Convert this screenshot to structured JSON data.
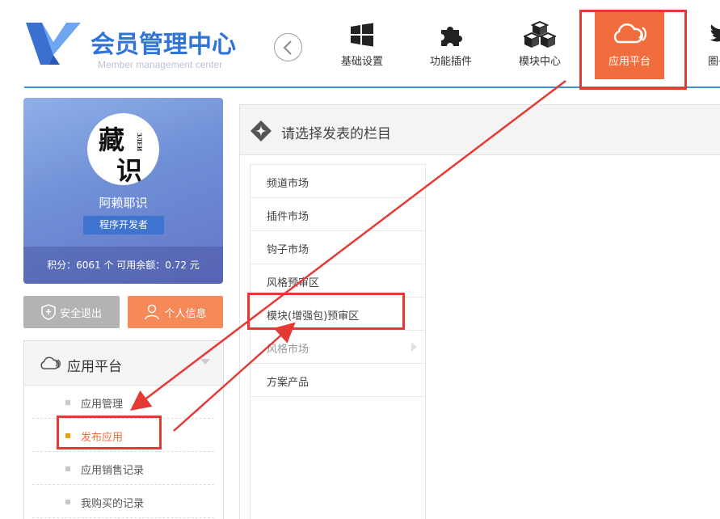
{
  "header": {
    "logo_title": "会员管理中心",
    "logo_subtitle": "Member management center",
    "nav": [
      {
        "label": "基础设置",
        "icon": "windows-icon"
      },
      {
        "label": "功能插件",
        "icon": "puzzle-icon"
      },
      {
        "label": "模块中心",
        "icon": "cubes-icon"
      },
      {
        "label": "应用平台",
        "icon": "cloud-icon",
        "active": true
      },
      {
        "label": "圈子",
        "icon": "twitter-bird-icon"
      }
    ]
  },
  "profile": {
    "avatar_text": [
      "藏",
      "识"
    ],
    "avatar_side_text": "ЗЛЕИ",
    "username": "阿赖耶识",
    "role": "程序开发者",
    "stats": "积分：6061  个  可用余额：0.72  元"
  },
  "buttons": {
    "logout": "安全退出",
    "personal_info": "个人信息"
  },
  "side_menu": {
    "title": "应用平台",
    "items": [
      {
        "label": "应用管理"
      },
      {
        "label": "发布应用",
        "active": true
      },
      {
        "label": "应用销售记录"
      },
      {
        "label": "我购买的记录"
      }
    ]
  },
  "main": {
    "title": "请选择发表的栏目",
    "categories": [
      {
        "label": "频道市场"
      },
      {
        "label": "插件市场"
      },
      {
        "label": "钩子市场"
      },
      {
        "label": "风格预审区"
      },
      {
        "label": "模块(增强包)预审区"
      },
      {
        "label": "风格市场",
        "muted": true
      },
      {
        "label": "方案产品"
      }
    ]
  },
  "colors": {
    "accent_orange": "#f26d3d",
    "brand_blue": "#2f74d6",
    "annotation_red": "#e53935"
  }
}
